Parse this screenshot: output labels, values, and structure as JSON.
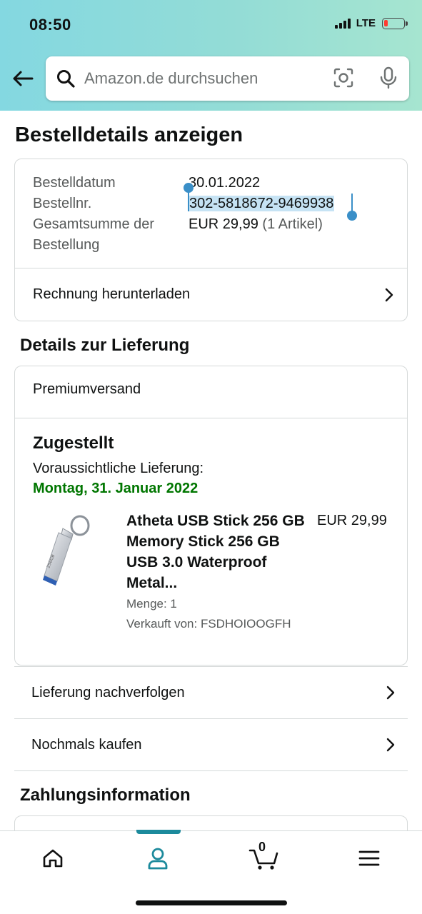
{
  "status_bar": {
    "time": "08:50",
    "network": "LTE",
    "battery_level": 0.2,
    "battery_color": "#ff3b30"
  },
  "search": {
    "placeholder": "Amazon.de durchsuchen",
    "back_icon": "arrow-left-icon",
    "search_icon": "magnifier-icon",
    "camera_icon": "camera-scan-icon",
    "mic_icon": "microphone-icon"
  },
  "page": {
    "title": "Bestelldetails anzeigen"
  },
  "order": {
    "date_label": "Bestelldatum",
    "date_value": "30.01.2022",
    "number_label": "Bestellnr.",
    "number_value": "302-5818672-9469938",
    "total_label_line1": "Gesamtsumme der",
    "total_label_line2": "Bestellung",
    "total_value": "EUR 29,99",
    "total_count": "(1 Artikel)",
    "invoice_link": "Rechnung herunterladen"
  },
  "delivery": {
    "section_title": "Details zur Lieferung",
    "shipping_method": "Premiumversand",
    "status": "Zugestellt",
    "expected_label": "Voraussichtliche Lieferung:",
    "expected_date": "Montag, 31. Januar 2022",
    "accent_color": "#007600",
    "product": {
      "title": "Atheta USB Stick 256 GB Memory Stick 256 GB USB 3.0 Waterproof Metal...",
      "price": "EUR 29,99",
      "quantity": "Menge: 1",
      "seller": "Verkauft von: FSDHOIOOGFH",
      "image_icon": "usb-stick-image"
    },
    "track_link": "Lieferung nachverfolgen",
    "buy_again_link": "Nochmals kaufen"
  },
  "payment": {
    "section_title": "Zahlungsinformation"
  },
  "bottom_nav": {
    "items": [
      {
        "name": "home",
        "icon": "home-icon"
      },
      {
        "name": "account",
        "icon": "user-icon",
        "active": true
      },
      {
        "name": "cart",
        "icon": "cart-icon",
        "count": "0"
      },
      {
        "name": "menu",
        "icon": "hamburger-menu-icon"
      }
    ],
    "active_color": "#1c8a9c"
  }
}
